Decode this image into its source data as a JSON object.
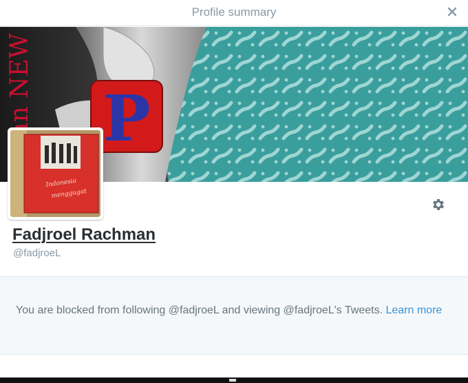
{
  "modal": {
    "title": "Profile summary",
    "close_icon": "close-icon"
  },
  "banner": {
    "description_icon": "banner-image",
    "overlay_letter": "P",
    "overlay_text": "an NEW"
  },
  "avatar": {
    "icon": "avatar-image",
    "cover_script_text": "Indonesia menggugat"
  },
  "settings": {
    "icon": "gear-icon"
  },
  "profile": {
    "name": "Fadjroel Rachman",
    "handle": "@fadjroeL"
  },
  "blocked": {
    "message": "You are blocked from following @fadjroeL and viewing @fadjroeL's Tweets.",
    "learn_more": "Learn more"
  },
  "colors": {
    "banner_teal": "#3a9e9d",
    "link_blue": "#3b94d9",
    "muted_gray": "#8899a6",
    "panel_bg": "#f5f8fa"
  }
}
